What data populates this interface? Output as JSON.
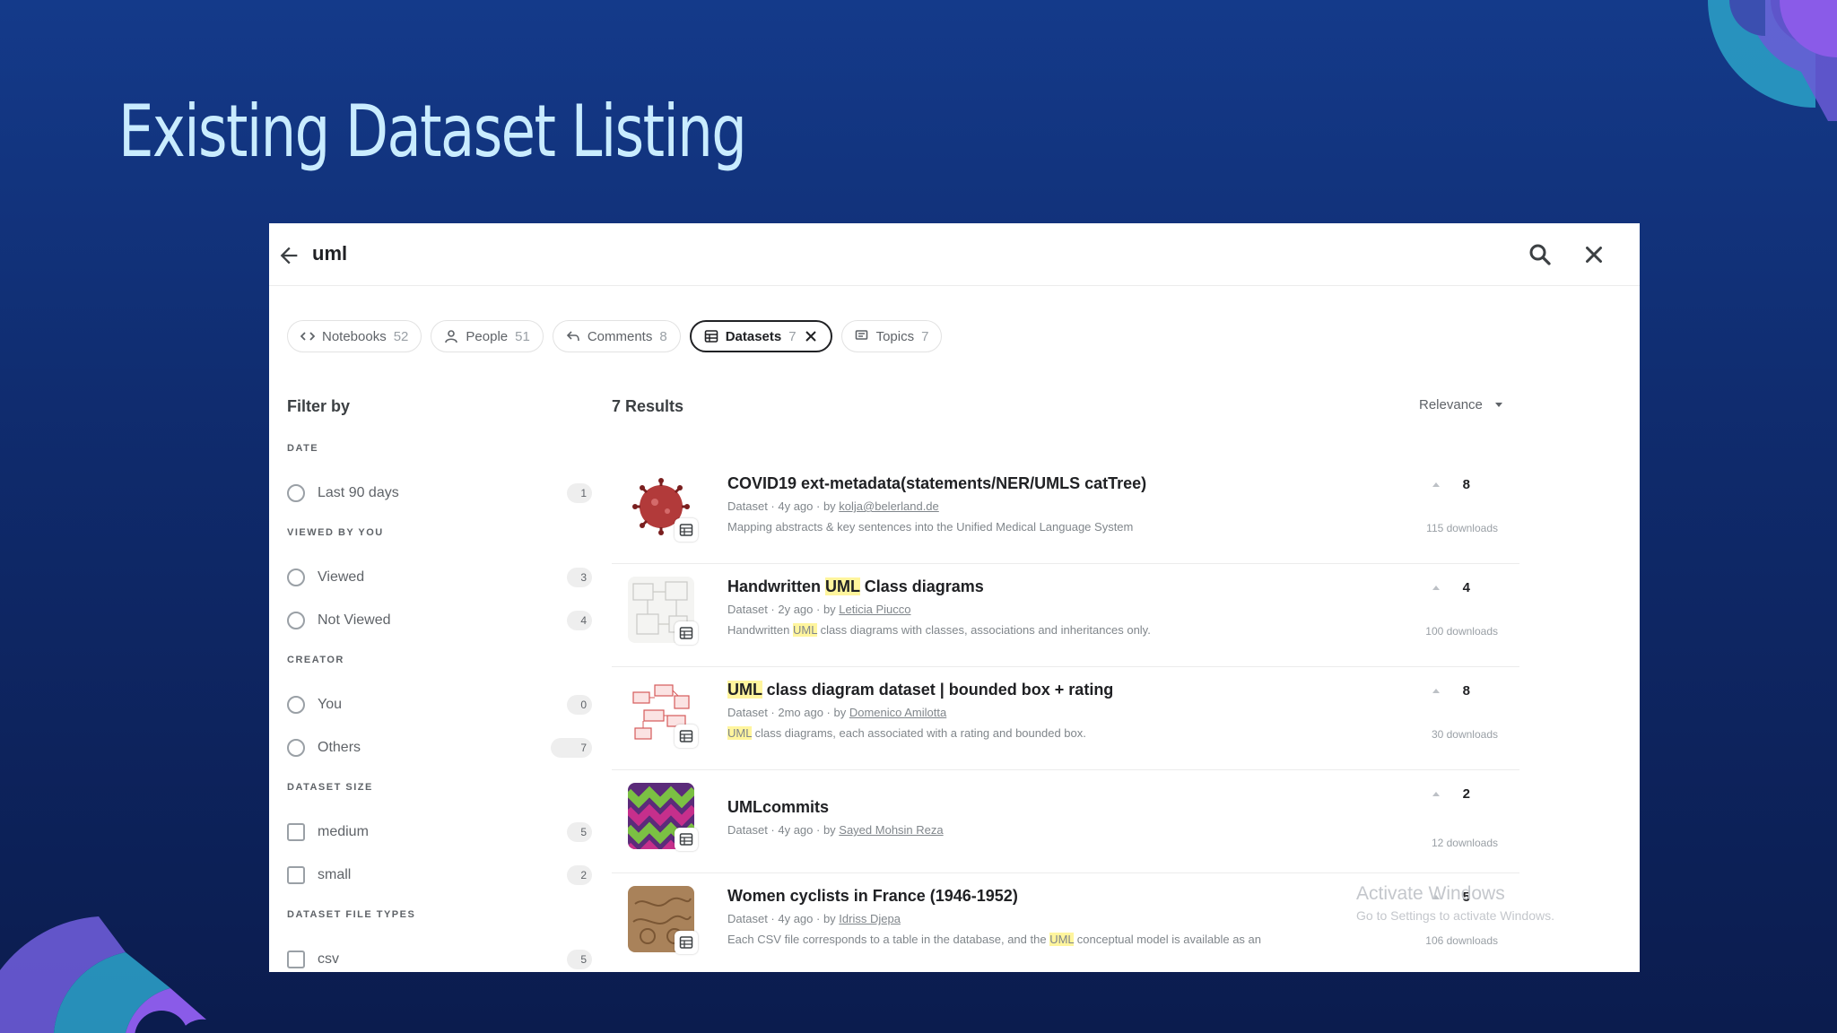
{
  "slide": {
    "title": "Existing Dataset Listing",
    "accent_colors": [
      "#2a9cc4",
      "#6b5bd6",
      "#8a5be8",
      "#3b4fb0"
    ]
  },
  "topbar": {
    "query": "uml",
    "back_icon": "arrow-left-icon",
    "search_icon": "search-icon",
    "close_icon": "close-icon"
  },
  "tabs": [
    {
      "label": "Notebooks",
      "count": "52",
      "icon": "code-icon"
    },
    {
      "label": "People",
      "count": "51",
      "icon": "person-icon"
    },
    {
      "label": "Comments",
      "count": "8",
      "icon": "reply-icon"
    },
    {
      "label": "Datasets",
      "count": "7",
      "icon": "table-icon",
      "active": true
    },
    {
      "label": "Topics",
      "count": "7",
      "icon": "forum-icon"
    }
  ],
  "filters": {
    "title": "Filter by",
    "groups": [
      {
        "label": "DATE",
        "items": [
          {
            "label": "Last 90 days",
            "count": "1"
          }
        ]
      },
      {
        "label": "VIEWED BY YOU",
        "items": [
          {
            "label": "Viewed",
            "count": "3"
          },
          {
            "label": "Not Viewed",
            "count": "4"
          }
        ]
      },
      {
        "label": "CREATOR",
        "items": [
          {
            "label": "You",
            "count": "0"
          },
          {
            "label": "Others",
            "count": "7"
          }
        ]
      },
      {
        "label": "DATASET SIZE",
        "items": [
          {
            "label": "medium",
            "count": "5"
          },
          {
            "label": "small",
            "count": "2"
          }
        ]
      },
      {
        "label": "DATASET FILE TYPES",
        "items": [
          {
            "label": "csv",
            "count": "5"
          }
        ]
      }
    ]
  },
  "results": {
    "count_label": "7 Results",
    "sort_label": "Relevance",
    "items": [
      {
        "title": "COVID19 ext-metadata(statements/NER/UMLS catTree)",
        "meta_prefix": "Dataset · 4y ago · by ",
        "author": "kolja@belerland.de",
        "description": "Mapping abstracts & key sentences into the Unified Medical Language System",
        "votes": "8",
        "downloads": "115 downloads"
      },
      {
        "title": "Handwritten UML Class diagrams",
        "meta_prefix": "Dataset · 2y ago · by ",
        "author": "Leticia Piucco",
        "description": "Handwritten UML class diagrams with classes, associations and inheritances only.",
        "votes": "4",
        "downloads": "100 downloads"
      },
      {
        "title": "UML class diagram dataset | bounded box + rating",
        "meta_prefix": "Dataset · 2mo ago · by ",
        "author": "Domenico Amilotta",
        "description": "UML class diagrams, each associated with a rating and bounded box.",
        "votes": "8",
        "downloads": "30 downloads"
      },
      {
        "title": "UMLcommits",
        "meta_prefix": "Dataset · 4y ago · by ",
        "author": "Sayed Mohsin Reza",
        "description": "",
        "votes": "2",
        "downloads": "12 downloads"
      },
      {
        "title": "Women cyclists in France (1946-1952)",
        "meta_prefix": "Dataset · 4y ago · by ",
        "author": "Idriss Djepa",
        "description": "Each CSV file corresponds to a table in the database, and the UML conceptual model is available as an",
        "votes": "5",
        "downloads": "106 downloads"
      }
    ]
  },
  "watermark": {
    "line1": "Activate Windows",
    "line2": "Go to Settings to activate Windows."
  }
}
